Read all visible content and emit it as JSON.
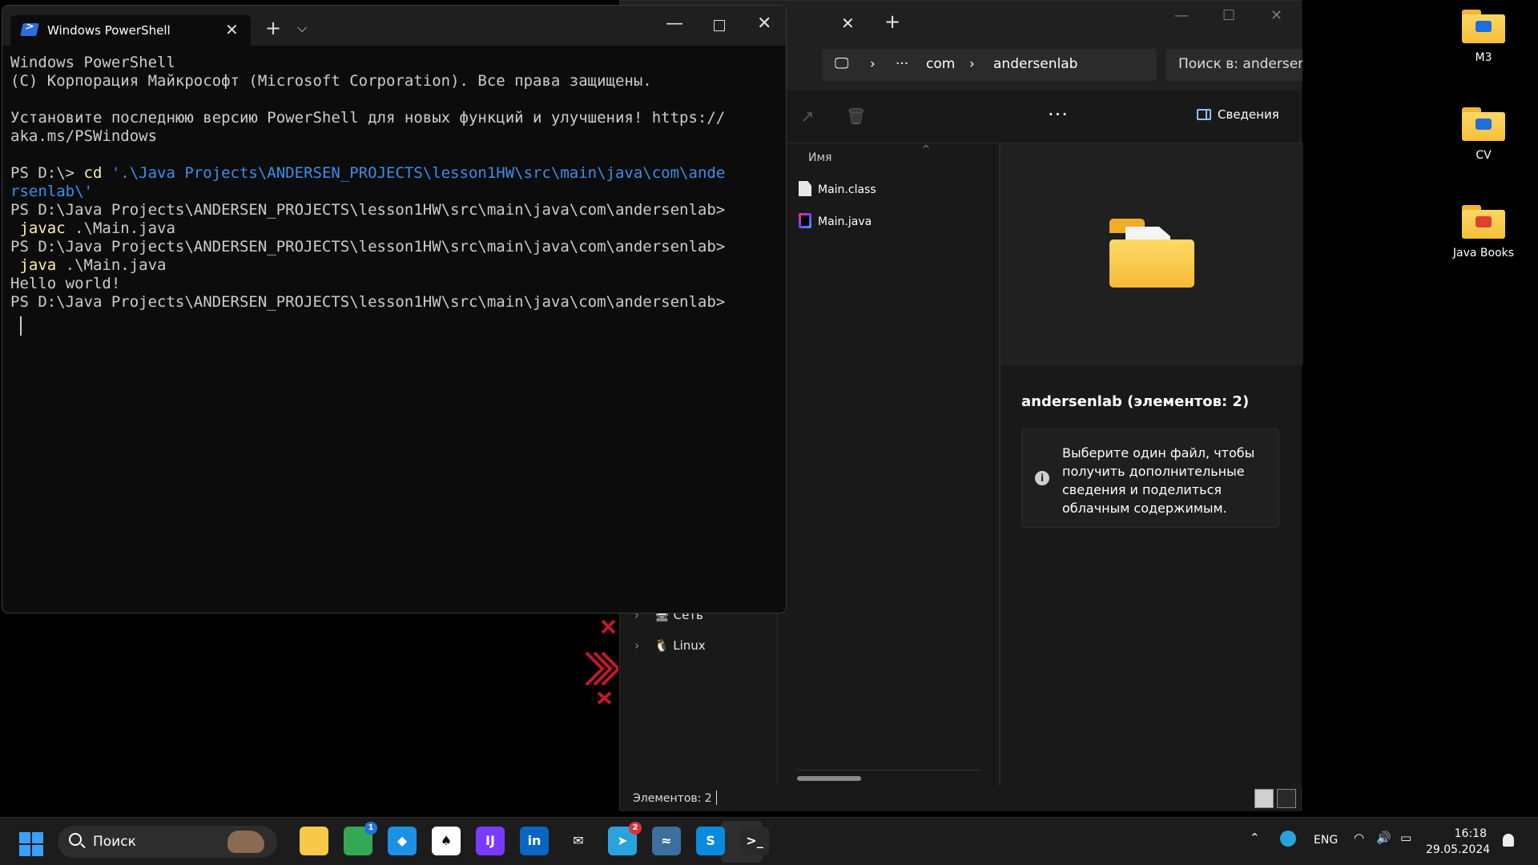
{
  "desktop": {
    "icons": [
      {
        "label": "M3",
        "badge_color": "#1e6fd9"
      },
      {
        "label": "CV",
        "badge_color": "#1e6fd9"
      },
      {
        "label": "Java Books",
        "badge_color": "#e04030"
      }
    ]
  },
  "terminal": {
    "tab_title": "Windows PowerShell",
    "lines": [
      [
        {
          "t": "Windows PowerShell",
          "c": "w"
        }
      ],
      [
        {
          "t": "(C) Корпорация Майкрософт (Microsoft Corporation). Все права защищены.",
          "c": "w"
        }
      ],
      [
        {
          "t": "",
          "c": "w"
        }
      ],
      [
        {
          "t": "Установите последнюю версию PowerShell для новых функций и улучшения! https://",
          "c": "w"
        }
      ],
      [
        {
          "t": "aka.ms/PSWindows",
          "c": "w"
        }
      ],
      [
        {
          "t": "",
          "c": "w"
        }
      ],
      [
        {
          "t": "PS D:\\> ",
          "c": "w"
        },
        {
          "t": "cd",
          "c": "y"
        },
        {
          "t": " '.\\Java Projects\\ANDERSEN_PROJECTS\\lesson1HW\\src\\main\\java\\com\\ande",
          "c": "b"
        }
      ],
      [
        {
          "t": "rsenlab\\'",
          "c": "b"
        }
      ],
      [
        {
          "t": "PS D:\\Java Projects\\ANDERSEN_PROJECTS\\lesson1HW\\src\\main\\java\\com\\andersenlab>",
          "c": "w"
        }
      ],
      [
        {
          "t": " javac",
          "c": "y"
        },
        {
          "t": " .\\Main.java",
          "c": "w"
        }
      ],
      [
        {
          "t": "PS D:\\Java Projects\\ANDERSEN_PROJECTS\\lesson1HW\\src\\main\\java\\com\\andersenlab>",
          "c": "w"
        }
      ],
      [
        {
          "t": " java",
          "c": "y"
        },
        {
          "t": " .\\Main.java",
          "c": "w"
        }
      ],
      [
        {
          "t": "Hello world!",
          "c": "w"
        }
      ],
      [
        {
          "t": "PS D:\\Java Projects\\ANDERSEN_PROJECTS\\lesson1HW\\src\\main\\java\\com\\andersenlab>",
          "c": "w"
        }
      ]
    ],
    "colors": {
      "w": "#cccccc",
      "y": "#f9f1a5",
      "b": "#3b8eea"
    }
  },
  "explorer": {
    "address": {
      "ellipsis": "···",
      "segments": [
        "com",
        "andersenlab"
      ]
    },
    "search_placeholder": "Поиск в: andersenlab",
    "toolbar": {
      "more": "···",
      "details_label": "Сведения"
    },
    "column_name": "Имя",
    "files": [
      {
        "name": "Main.class",
        "icon": "class-file-icon"
      },
      {
        "name": "Main.java",
        "icon": "java-file-icon"
      }
    ],
    "nav_items": [
      {
        "label": "Сеть",
        "icon": "network-icon"
      },
      {
        "label": "Linux",
        "icon": "linux-icon"
      }
    ],
    "details": {
      "title": "andersenlab (элементов: 2)",
      "hint": "Выберите один файл, чтобы получить дополнительные сведения и поделиться облачным содержимым."
    },
    "status": {
      "count": "Элементов: 2"
    }
  },
  "taskbar": {
    "search_label": "Поиск",
    "apps": [
      {
        "name": "file-explorer-icon",
        "bg": "#f7c948",
        "glyph": ""
      },
      {
        "name": "chrome-icon",
        "bg": "#34a853",
        "glyph": "",
        "badge": "1",
        "badge_color": "#1a73e8"
      },
      {
        "name": "docker-icon",
        "bg": "#1d91e6",
        "glyph": "◆"
      },
      {
        "name": "github-desktop-icon",
        "bg": "#ffffff",
        "glyph": "♠"
      },
      {
        "name": "intellij-icon",
        "bg": "#7b3bff",
        "glyph": "IJ"
      },
      {
        "name": "linkedin-icon",
        "bg": "#0a66c2",
        "glyph": "in"
      },
      {
        "name": "mail-icon",
        "bg": "#1c1c1c",
        "glyph": "✉"
      },
      {
        "name": "telegram-icon",
        "bg": "#2aa3dd",
        "glyph": "➤",
        "badge": "2",
        "badge_color": "#e0323b"
      },
      {
        "name": "mysql-workbench-icon",
        "bg": "#3d6e9e",
        "glyph": "≈"
      },
      {
        "name": "skype-icon",
        "bg": "#0a8be0",
        "glyph": "S"
      },
      {
        "name": "terminal-icon",
        "bg": "#2a2a2a",
        "glyph": ">_"
      }
    ],
    "language": "ENG",
    "time": "16:18",
    "date": "29.05.2024"
  }
}
